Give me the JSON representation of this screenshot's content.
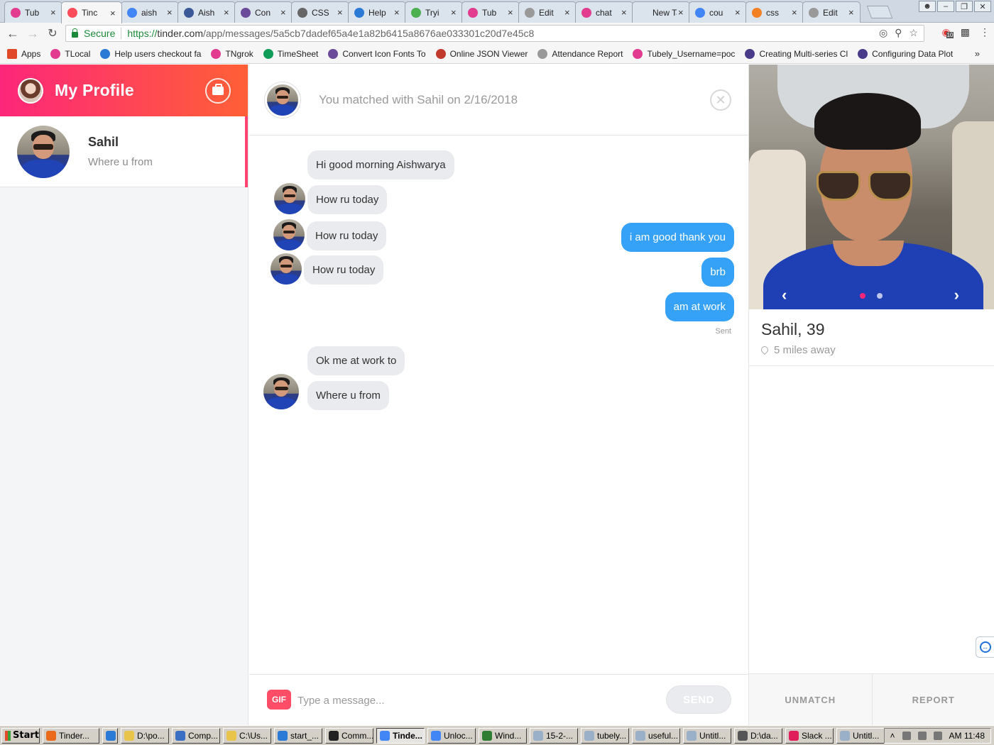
{
  "browser": {
    "tabs": [
      {
        "title": "Tub",
        "icon": "tubely-icon",
        "color": "#e33b8f"
      },
      {
        "title": "Tinc",
        "icon": "tinder-flame-icon",
        "color": "#fd4d5a",
        "active": true
      },
      {
        "title": "aish",
        "icon": "google-icon",
        "color": "#4285f4"
      },
      {
        "title": "Aish",
        "icon": "sb-icon",
        "color": "#3b5998"
      },
      {
        "title": "Con",
        "icon": "image-icon",
        "color": "#6b4a9a"
      },
      {
        "title": "CSS",
        "icon": "dot-icon",
        "color": "#666666"
      },
      {
        "title": "Help",
        "icon": "code-icon",
        "color": "#2a7ad6"
      },
      {
        "title": "Tryi",
        "icon": "w3-icon",
        "color": "#4caf50"
      },
      {
        "title": "Tub",
        "icon": "tubely-icon",
        "color": "#e33b8f"
      },
      {
        "title": "Edit",
        "icon": "page-icon",
        "color": "#999999"
      },
      {
        "title": "chat",
        "icon": "tubely-icon",
        "color": "#e33b8f"
      },
      {
        "title": "New Tab",
        "icon": "none",
        "color": "#ffffff"
      },
      {
        "title": "cou",
        "icon": "google-icon",
        "color": "#4285f4"
      },
      {
        "title": "css",
        "icon": "stack-icon",
        "color": "#f48024"
      },
      {
        "title": "Edit",
        "icon": "page-icon",
        "color": "#999999"
      }
    ],
    "secure_label": "Secure",
    "url_scheme": "https://",
    "url_host": "tinder.com",
    "url_path": "/app/messages/5a5cb7dadef65a4e1a82b6415a8676ae033301c20d7e45c8",
    "extension_badge": "10",
    "bookmarks": [
      {
        "label": "Apps",
        "icon": "apps-grid-icon",
        "color": "#e04a2a"
      },
      {
        "label": "TLocal",
        "icon": "tubely-icon",
        "color": "#e33b8f"
      },
      {
        "label": "Help users checkout fa",
        "icon": "code-icon",
        "color": "#2a7ad6"
      },
      {
        "label": "TNgrok",
        "icon": "tubely-icon",
        "color": "#e33b8f"
      },
      {
        "label": "TimeSheet",
        "icon": "sheet-icon",
        "color": "#0f9d58"
      },
      {
        "label": "Convert Icon Fonts To",
        "icon": "image-icon",
        "color": "#6b4a9a"
      },
      {
        "label": "Online JSON Viewer",
        "icon": "json-icon",
        "color": "#c0392b"
      },
      {
        "label": "Attendance Report",
        "icon": "page-icon",
        "color": "#999999"
      },
      {
        "label": "Tubely_Username=poc",
        "icon": "tubely-icon",
        "color": "#e33b8f"
      },
      {
        "label": "Creating Multi-series Cl",
        "icon": "fusion-icon",
        "color": "#4a3b8a"
      },
      {
        "label": "Configuring Data Plot",
        "icon": "fusion-icon",
        "color": "#4a3b8a"
      }
    ],
    "more_label": "»"
  },
  "left": {
    "title": "My Profile",
    "matches": [
      {
        "name": "Sahil",
        "preview": "Where u from"
      }
    ]
  },
  "chat": {
    "match_info": "You matched with Sahil on 2/16/2018",
    "messages": {
      "m1": "Hi good morning Aishwarya",
      "m2": "How ru today",
      "m3": "How ru today",
      "m4": "How ru today",
      "m5": "i am good thank you",
      "m6": "brb",
      "m7": "am at work",
      "m8": "Ok me at work to",
      "m9": "Where u from"
    },
    "sent_label": "Sent",
    "gif_label": "GIF",
    "input_placeholder": "Type a message...",
    "send_label": "SEND"
  },
  "profile": {
    "name_age": "Sahil, 39",
    "distance": "5 miles away",
    "photo_index": 1,
    "photo_count": 2,
    "unmatch_label": "UNMATCH",
    "report_label": "REPORT"
  },
  "colors": {
    "brand_gradient_start": "#fd267a",
    "brand_gradient_end": "#ff6036",
    "outgoing_bubble": "#36a2f7",
    "incoming_bubble": "#e9ebee"
  },
  "taskbar": {
    "start_label": "Start",
    "tasks": [
      {
        "label": "Tinder...",
        "color": "#e86a1a"
      },
      {
        "label": "",
        "color": "#2a7ad6"
      },
      {
        "label": "D:\\po...",
        "color": "#e9c44a"
      },
      {
        "label": "Comp...",
        "color": "#3a6fc4"
      },
      {
        "label": "C:\\Us...",
        "color": "#e9c44a"
      },
      {
        "label": "start_...",
        "color": "#2a7ad6"
      },
      {
        "label": "Comm...",
        "color": "#222222"
      },
      {
        "label": "Tinde...",
        "color": "#4285f4",
        "active": true
      },
      {
        "label": "Unloc...",
        "color": "#4285f4"
      },
      {
        "label": "Wind...",
        "color": "#2e7d32"
      },
      {
        "label": "15-2-...",
        "color": "#9ab0c8"
      },
      {
        "label": "tubely...",
        "color": "#9ab0c8"
      },
      {
        "label": "useful...",
        "color": "#9ab0c8"
      },
      {
        "label": "Untitl...",
        "color": "#9ab0c8"
      },
      {
        "label": "D:\\da...",
        "color": "#555555"
      },
      {
        "label": "Slack ...",
        "color": "#e01e5a"
      },
      {
        "label": "Untitl...",
        "color": "#9ab0c8"
      }
    ],
    "clock": "AM 11:48"
  }
}
